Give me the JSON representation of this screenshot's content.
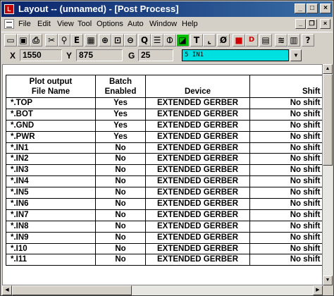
{
  "window": {
    "title": "Layout -- (unnamed) - [Post Process]",
    "app_icon": "L"
  },
  "title_buttons": {
    "minimize": "_",
    "maximize": "□",
    "close": "×"
  },
  "mdi_buttons": {
    "minimize": "_",
    "restore": "❐",
    "close": "×"
  },
  "menu": [
    "File",
    "Edit",
    "View",
    "Tool",
    "Options",
    "Auto",
    "Window",
    "Help"
  ],
  "toolbar": {
    "icons": [
      {
        "name": "new-icon",
        "glyph": "▭"
      },
      {
        "name": "save-icon",
        "glyph": "▣"
      },
      {
        "name": "print-icon",
        "glyph": "⎙"
      },
      {
        "name": "cut-icon",
        "glyph": "✂"
      },
      {
        "name": "binoculars-icon",
        "glyph": "⚲"
      },
      {
        "name": "text-e-icon",
        "glyph": "E"
      },
      {
        "name": "grid-icon",
        "glyph": "▦"
      },
      {
        "name": "zoom-in-icon",
        "glyph": "⊕"
      },
      {
        "name": "zoom-window-icon",
        "glyph": "⊡"
      },
      {
        "name": "zoom-out-icon",
        "glyph": "⊖"
      },
      {
        "name": "query-icon",
        "glyph": "Q"
      },
      {
        "name": "component-icon",
        "glyph": "☰"
      },
      {
        "name": "pad-icon",
        "glyph": "⦶"
      },
      {
        "name": "fill-icon",
        "glyph": "◪"
      },
      {
        "name": "text-tool-icon",
        "glyph": "T"
      },
      {
        "name": "measure-icon",
        "glyph": "⌞"
      },
      {
        "name": "no-connect-icon",
        "glyph": "Ø"
      },
      {
        "name": "color-icon",
        "glyph": "■"
      },
      {
        "name": "drc-icon",
        "glyph": "D"
      },
      {
        "name": "layer-icon",
        "glyph": "▤"
      },
      {
        "name": "route-icon",
        "glyph": "≋"
      },
      {
        "name": "properties-icon",
        "glyph": "▥"
      },
      {
        "name": "help-icon",
        "glyph": "?"
      }
    ]
  },
  "coords": {
    "x_label": "X",
    "x_value": "1550",
    "y_label": "Y",
    "y_value": "875",
    "g_label": "G",
    "g_value": "25",
    "layer": "5 IN1"
  },
  "colors": {
    "title_start": "#0a246a",
    "title_end": "#3a6ea5",
    "layer_bg": "#00e0e0"
  },
  "table": {
    "headers": {
      "file_l1": "Plot output",
      "file_l2": "File Name",
      "batch_l1": "Batch",
      "batch_l2": "Enabled",
      "device": "Device",
      "shift": "Shift"
    },
    "rows": [
      {
        "file": "*.TOP",
        "batch": "Yes",
        "device": "EXTENDED GERBER",
        "shift": "No shift"
      },
      {
        "file": "*.BOT",
        "batch": "Yes",
        "device": "EXTENDED GERBER",
        "shift": "No shift"
      },
      {
        "file": "*.GND",
        "batch": "Yes",
        "device": "EXTENDED GERBER",
        "shift": "No shift"
      },
      {
        "file": "*.PWR",
        "batch": "Yes",
        "device": "EXTENDED GERBER",
        "shift": "No shift"
      },
      {
        "file": "*.IN1",
        "batch": "No",
        "device": "EXTENDED GERBER",
        "shift": "No shift"
      },
      {
        "file": "*.IN2",
        "batch": "No",
        "device": "EXTENDED GERBER",
        "shift": "No shift"
      },
      {
        "file": "*.IN3",
        "batch": "No",
        "device": "EXTENDED GERBER",
        "shift": "No shift"
      },
      {
        "file": "*.IN4",
        "batch": "No",
        "device": "EXTENDED GERBER",
        "shift": "No shift"
      },
      {
        "file": "*.IN5",
        "batch": "No",
        "device": "EXTENDED GERBER",
        "shift": "No shift"
      },
      {
        "file": "*.IN6",
        "batch": "No",
        "device": "EXTENDED GERBER",
        "shift": "No shift"
      },
      {
        "file": "*.IN7",
        "batch": "No",
        "device": "EXTENDED GERBER",
        "shift": "No shift"
      },
      {
        "file": "*.IN8",
        "batch": "No",
        "device": "EXTENDED GERBER",
        "shift": "No shift"
      },
      {
        "file": "*.IN9",
        "batch": "No",
        "device": "EXTENDED GERBER",
        "shift": "No shift"
      },
      {
        "file": "*.I10",
        "batch": "No",
        "device": "EXTENDED GERBER",
        "shift": "No shift"
      },
      {
        "file": "*.I11",
        "batch": "No",
        "device": "EXTENDED GERBER",
        "shift": "No shift"
      }
    ]
  }
}
